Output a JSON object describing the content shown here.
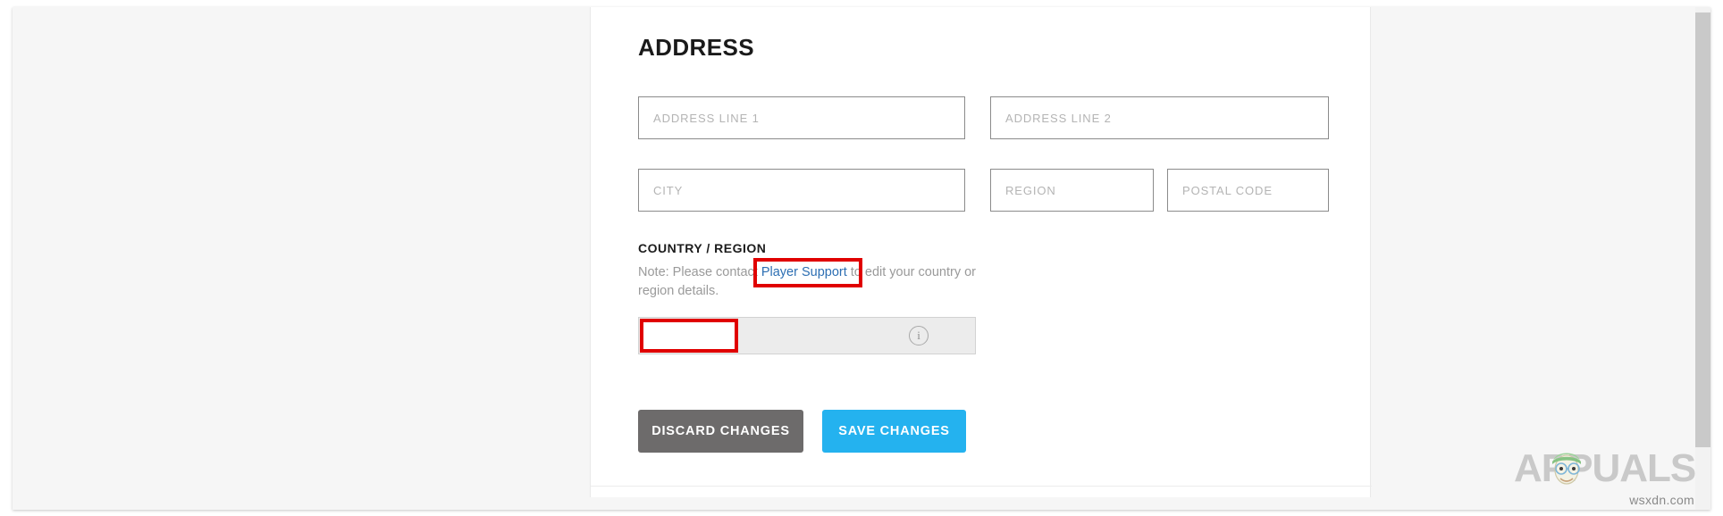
{
  "section": {
    "title": "ADDRESS"
  },
  "address_fields": [
    {
      "name": "address-line-1",
      "placeholder": "ADDRESS LINE 1",
      "value": ""
    },
    {
      "name": "address-line-2",
      "placeholder": "ADDRESS LINE 2",
      "value": ""
    },
    {
      "name": "city",
      "placeholder": "CITY",
      "value": ""
    },
    {
      "name": "region",
      "placeholder": "REGION",
      "value": ""
    },
    {
      "name": "postal-code",
      "placeholder": "POSTAL CODE",
      "value": ""
    }
  ],
  "country_section": {
    "heading": "COUNTRY / REGION",
    "note_prefix": "Note: Please contact ",
    "note_link": "Player Support",
    "note_suffix": " to edit your country or region details.",
    "selected_value": "",
    "info_icon_glyph": "i",
    "disabled": true
  },
  "actions": {
    "discard_label": "DISCARD CHANGES",
    "save_label": "SAVE CHANGES"
  },
  "watermark": {
    "brand": "APPUALS",
    "source": "wsxdn.com"
  },
  "colors": {
    "save_button": "#24b2ef",
    "discard_button": "#6d6b6b",
    "link": "#2d6fb3",
    "annotation": "#e00000",
    "field_border": "#8b8b8b",
    "disabled_field": "#ececec",
    "page_background": "#f6f6f6"
  }
}
